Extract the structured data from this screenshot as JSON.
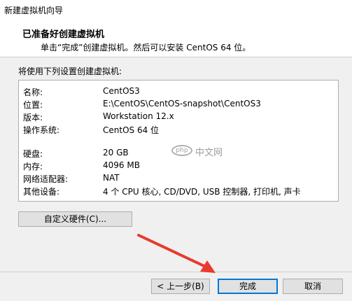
{
  "window": {
    "title": "新建虚拟机向导"
  },
  "header": {
    "title": "已准备好创建虚拟机",
    "subtitle": "单击“完成”创建虚拟机。然后可以安装 CentOS 64 位。"
  },
  "summary_label": "将使用下列设置创建虚拟机:",
  "summary": [
    {
      "key": "名称:",
      "value": "CentOS3"
    },
    {
      "key": "位置:",
      "value": "E:\\CentOS\\CentOS-snapshot\\CentOS3"
    },
    {
      "key": "版本:",
      "value": "Workstation 12.x"
    },
    {
      "key": "操作系统:",
      "value": "CentOS 64 位"
    },
    {
      "key": "硬盘:",
      "value": "20 GB"
    },
    {
      "key": "内存:",
      "value": "4096 MB"
    },
    {
      "key": "网络适配器:",
      "value": "NAT"
    },
    {
      "key": "其他设备:",
      "value": "4 个 CPU 核心, CD/DVD, USB 控制器, 打印机, 声卡"
    }
  ],
  "buttons": {
    "customize": "自定义硬件(C)...",
    "back": "< 上一步(B)",
    "finish": "完成",
    "cancel": "取消"
  },
  "watermark": {
    "logo": "php",
    "text": "中文网"
  },
  "colors": {
    "focus_border": "#0078d7",
    "arrow": "#e83a2e"
  }
}
